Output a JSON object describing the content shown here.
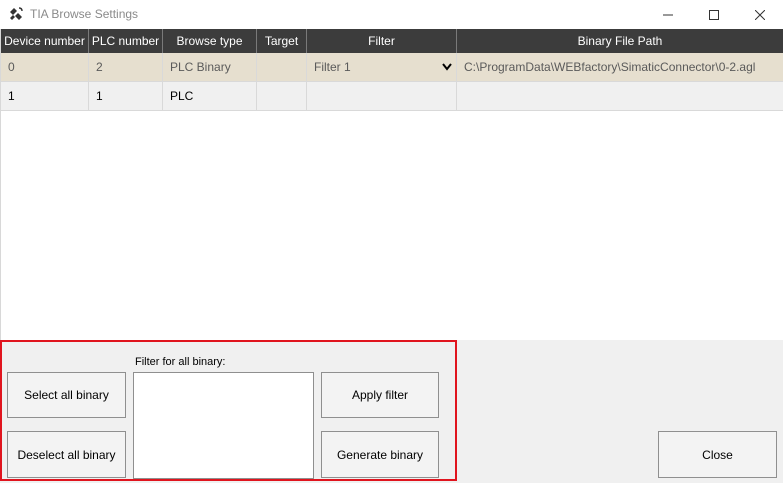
{
  "window": {
    "title": "TIA Browse Settings",
    "icon": "satellite-icon"
  },
  "grid": {
    "columns": [
      "Device number",
      "PLC number",
      "Browse type",
      "Target",
      "Filter",
      "Binary File Path"
    ],
    "rows": [
      {
        "device_number": "0",
        "plc_number": "2",
        "browse_type": "PLC Binary",
        "target": "",
        "filter": "Filter 1",
        "binary_file_path": "C:\\ProgramData\\WEBfactory\\SimaticConnector\\0-2.agl"
      },
      {
        "device_number": "1",
        "plc_number": "1",
        "browse_type": "PLC",
        "target": "",
        "filter": "",
        "binary_file_path": ""
      }
    ]
  },
  "bottom": {
    "select_all": "Select all binary",
    "deselect_all": "Deselect all binary",
    "filter_label": "Filter for all binary:",
    "filter_value": "",
    "apply_filter": "Apply filter",
    "generate_binary": "Generate binary",
    "close": "Close"
  },
  "colors": {
    "header_bg": "#3c3c3c",
    "selected_row_bg": "#e6dfcf",
    "highlight_border": "#e0141e"
  }
}
